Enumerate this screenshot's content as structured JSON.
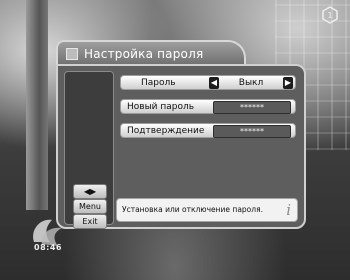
{
  "window": {
    "title": "Настройка пароля"
  },
  "rows": [
    {
      "label": "Пароль",
      "value": "Выкл",
      "left_arrow": "◀",
      "right_arrow": "▶"
    },
    {
      "label": "Новый пароль",
      "value": "******"
    },
    {
      "label": "Подтверждение",
      "value": "******"
    }
  ],
  "nav_keys": {
    "arrows": "◀▶",
    "menu": "Menu",
    "exit": "Exit"
  },
  "help": {
    "text": "Установка или отключение пароля.",
    "icon": "i"
  },
  "channel_overlay": {
    "time": "08:46"
  },
  "colors": {
    "panel": "#5e5e5e",
    "frame": "#d0d0d0",
    "title_bar": "#8a8a8a"
  }
}
